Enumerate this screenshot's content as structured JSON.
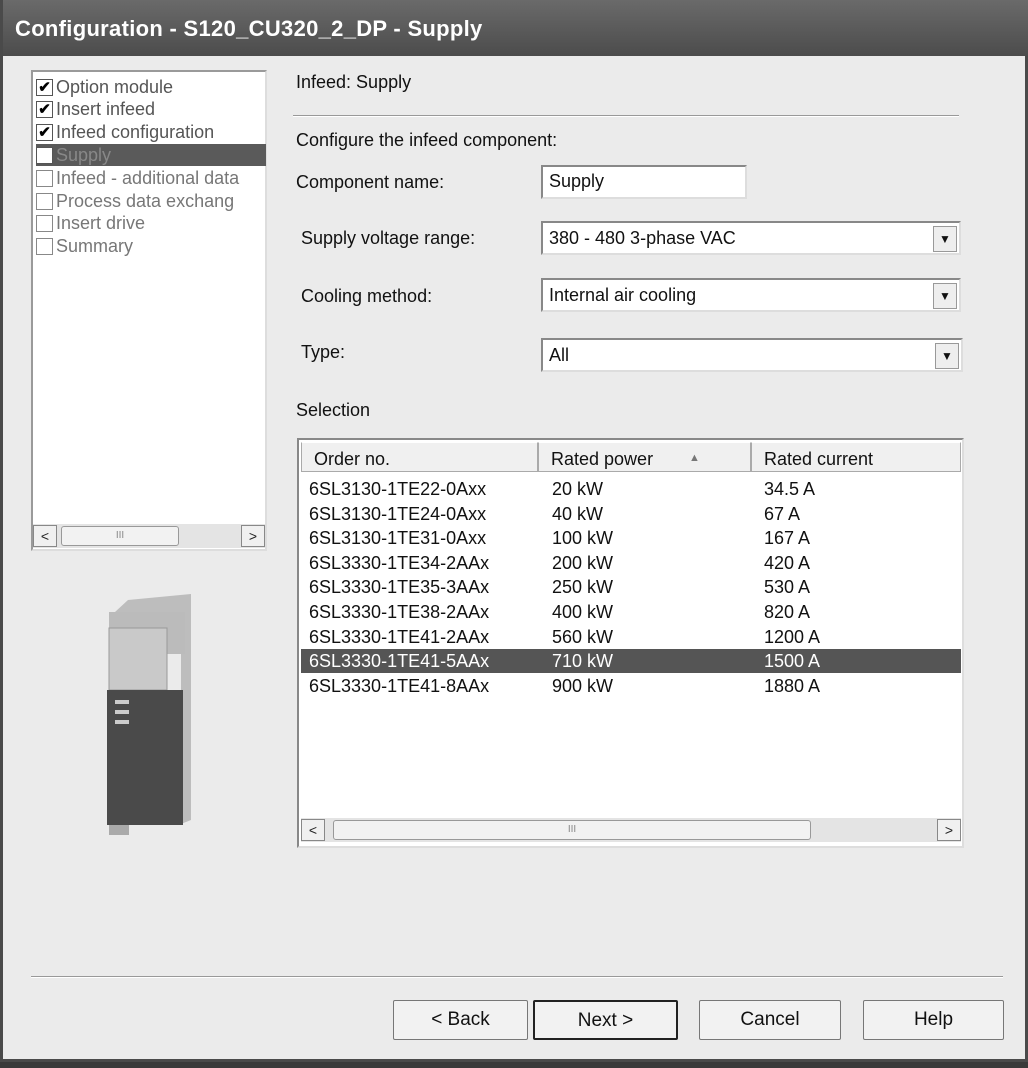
{
  "window": {
    "title": "Configuration - S120_CU320_2_DP - Supply"
  },
  "nav": {
    "items": [
      {
        "label": "Option module",
        "checked": true
      },
      {
        "label": "Insert infeed",
        "checked": true
      },
      {
        "label": "Infeed configuration",
        "checked": true
      },
      {
        "label": "Supply",
        "checked": false,
        "selected": true
      },
      {
        "label": "Infeed - additional data",
        "checked": false
      },
      {
        "label": "Process data exchang",
        "checked": false
      },
      {
        "label": "Insert drive",
        "checked": false
      },
      {
        "label": "Summary",
        "checked": false
      }
    ]
  },
  "page": {
    "header": "Infeed: Supply",
    "subtitle": "Configure the infeed component:"
  },
  "form": {
    "component_name_label": "Component name:",
    "component_name_value": "Supply",
    "voltage_label": "Supply voltage range:",
    "voltage_value": "380 - 480 3-phase VAC",
    "cooling_label": "Cooling method:",
    "cooling_value": "Internal air cooling",
    "type_label": "Type:",
    "type_value": "All"
  },
  "selection": {
    "label": "Selection",
    "columns": [
      "Order no.",
      "Rated power",
      "Rated current"
    ],
    "rows": [
      [
        "6SL3130-1TE22-0Axx",
        "20 kW",
        "34.5 A"
      ],
      [
        "6SL3130-1TE24-0Axx",
        "40 kW",
        "67 A"
      ],
      [
        "6SL3130-1TE31-0Axx",
        "100 kW",
        "167 A"
      ],
      [
        "6SL3330-1TE34-2AAx",
        "200 kW",
        "420 A"
      ],
      [
        "6SL3330-1TE35-3AAx",
        "250 kW",
        "530 A"
      ],
      [
        "6SL3330-1TE38-2AAx",
        "400 kW",
        "820 A"
      ],
      [
        "6SL3330-1TE41-2AAx",
        "560 kW",
        "1200 A"
      ],
      [
        "6SL3330-1TE41-5AAx",
        "710 kW",
        "1500 A"
      ],
      [
        "6SL3330-1TE41-8AAx",
        "900 kW",
        "1880 A"
      ]
    ],
    "selected_index": 7
  },
  "buttons": {
    "back": "< Back",
    "next": "Next >",
    "cancel": "Cancel",
    "help": "Help"
  }
}
